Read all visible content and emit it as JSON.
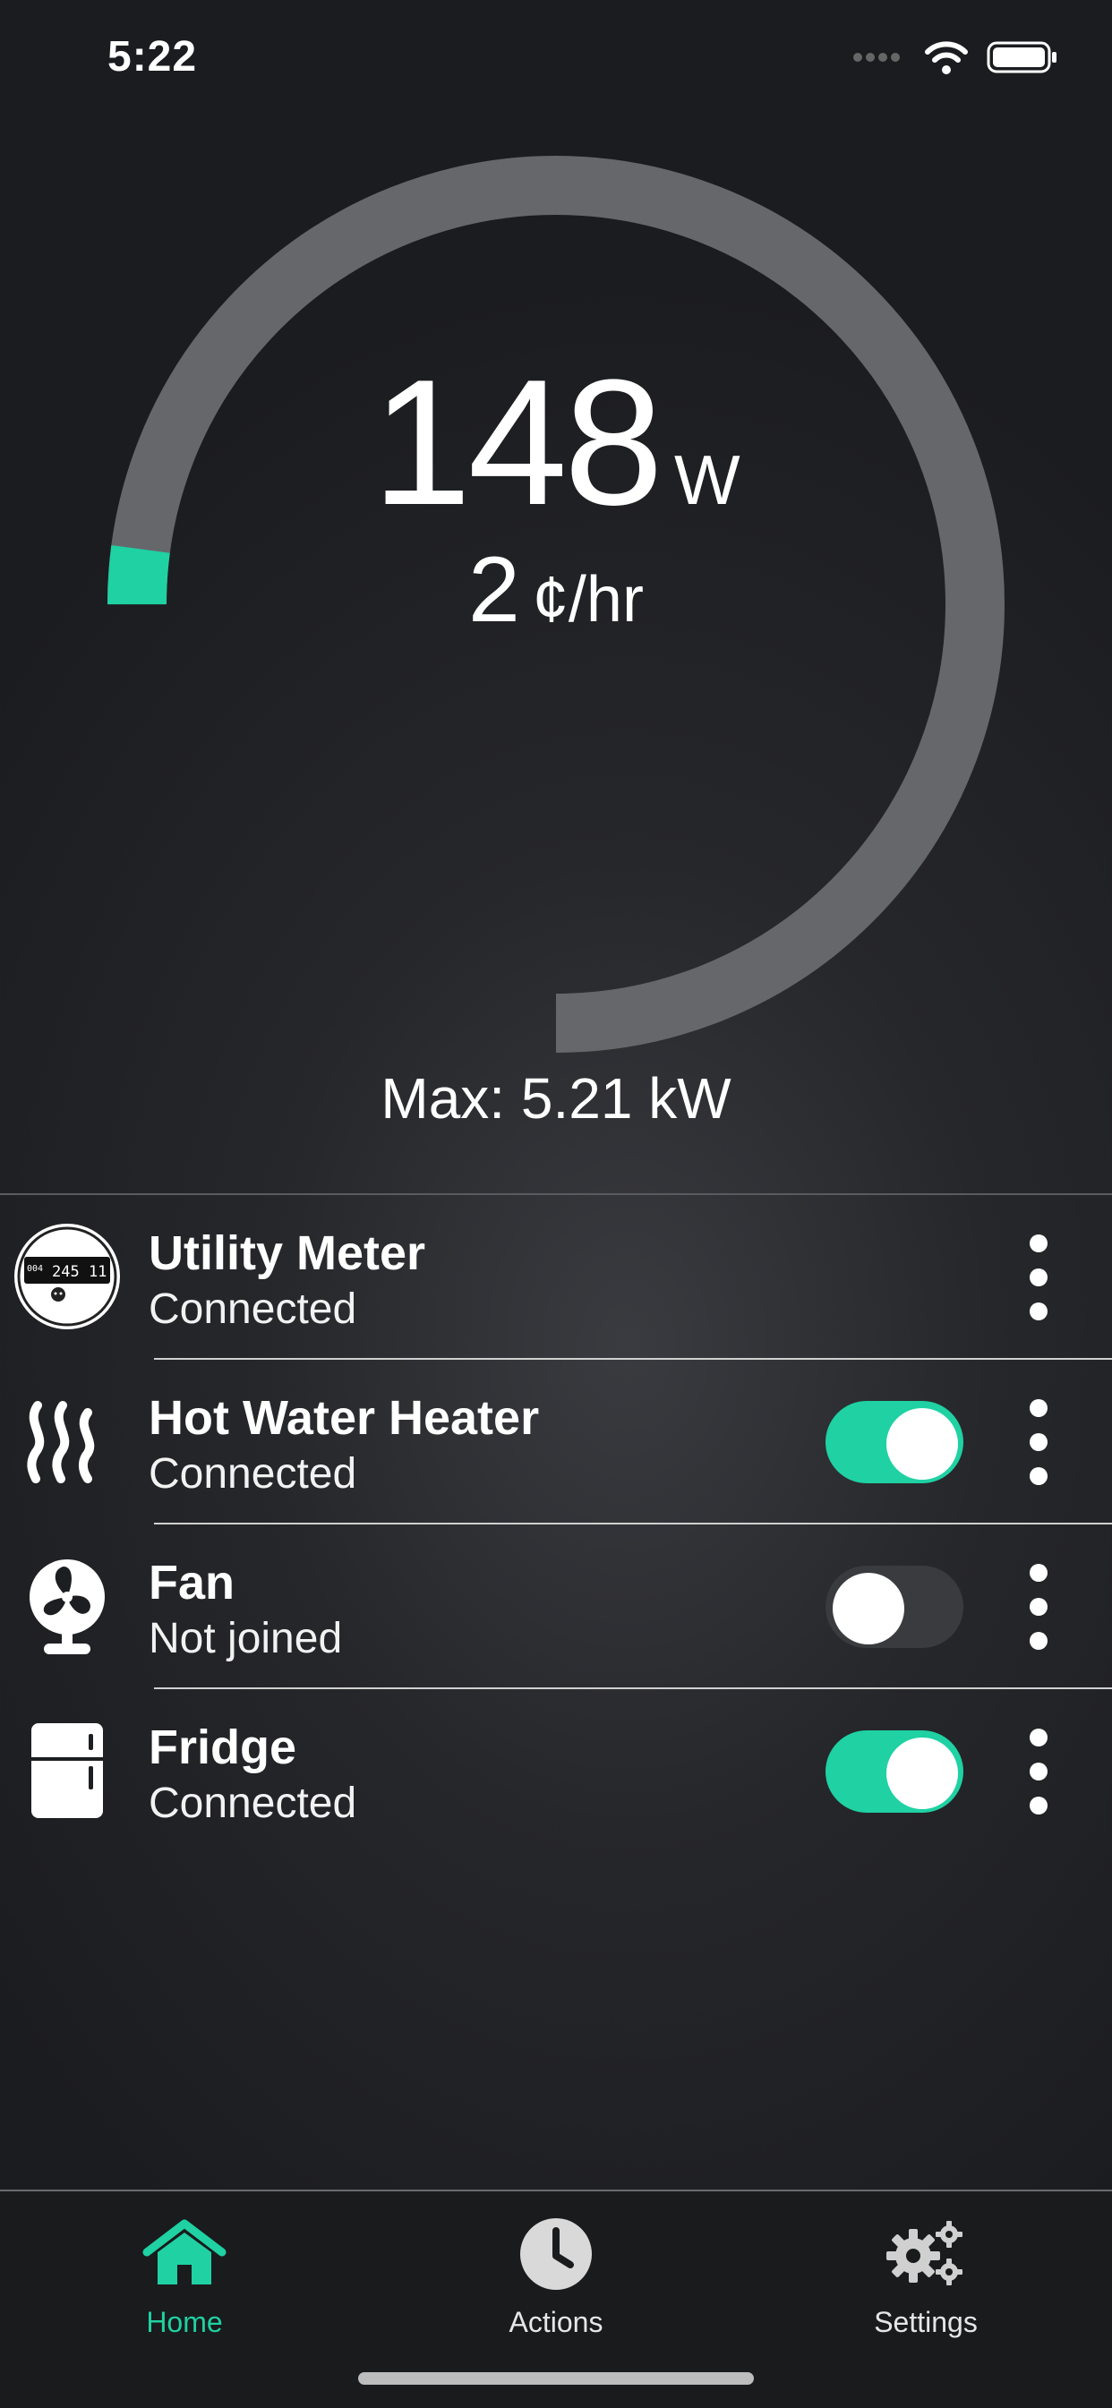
{
  "status_bar": {
    "time": "5:22"
  },
  "gauge": {
    "watts_value": "148",
    "watts_unit": "W",
    "cost_value": "2",
    "cost_unit": "¢/hr",
    "max_label": "Max: 5.21 kW",
    "fill_fraction": 0.028,
    "track_color": "#66676b",
    "fill_color": "#1fd1a3"
  },
  "devices": [
    {
      "name": "Utility Meter",
      "status": "Connected",
      "icon": "utility-meter-icon",
      "meter_reading_a": "004",
      "meter_reading_b": "245 11"
    },
    {
      "name": "Hot Water Heater",
      "status": "Connected",
      "icon": "heat-waves-icon",
      "toggle_on": true
    },
    {
      "name": "Fan",
      "status": "Not joined",
      "icon": "fan-icon",
      "toggle_on": false
    },
    {
      "name": "Fridge",
      "status": "Connected",
      "icon": "fridge-icon",
      "toggle_on": true
    }
  ],
  "tabbar": {
    "tabs": [
      {
        "label": "Home",
        "icon": "home-icon",
        "active": true
      },
      {
        "label": "Actions",
        "icon": "clock-icon",
        "active": false
      },
      {
        "label": "Settings",
        "icon": "gears-icon",
        "active": false
      }
    ]
  },
  "colors": {
    "accent": "#1fd1a3",
    "background": "#1b1c1f"
  }
}
